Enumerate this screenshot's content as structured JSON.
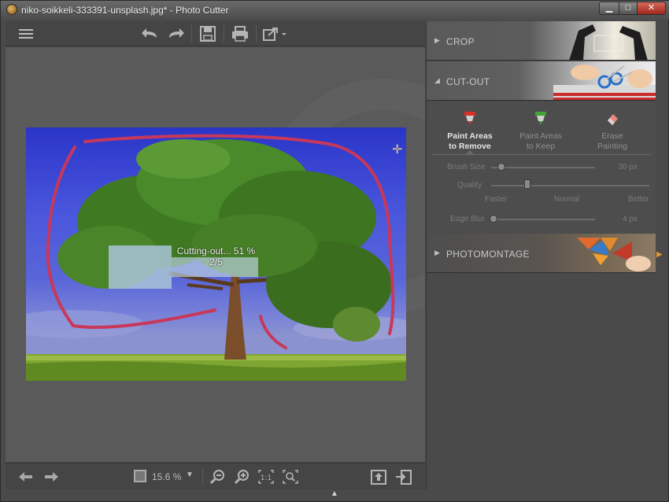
{
  "window": {
    "title": "niko-soikkeli-333391-unsplash.jpg* - Photo Cutter",
    "minimize": "▁",
    "maximize": "□",
    "close": "✕"
  },
  "toolbar": {
    "icons": [
      "menu-icon",
      "undo-icon",
      "redo-icon",
      "save-icon",
      "print-icon",
      "export-icon"
    ]
  },
  "canvas": {
    "progress_line1": "Cutting-out... 51 %",
    "progress_line2": "2/5",
    "progress_percent": 51
  },
  "bottombar": {
    "zoom": "15.6 %",
    "icons": [
      "prev-arrow-icon",
      "next-arrow-icon",
      "zoom-out-icon",
      "zoom-in-icon",
      "actual-size-icon",
      "fit-icon",
      "upload-icon",
      "exit-icon"
    ]
  },
  "panel": {
    "crop": {
      "label": "CROP"
    },
    "cutout": {
      "label": "CUT-OUT",
      "modes": {
        "remove": {
          "line1": "Paint Areas",
          "line2": "to Remove"
        },
        "keep": {
          "line1": "Paint Areas",
          "line2": "to Keep"
        },
        "erase": {
          "line1": "Erase",
          "line2": "Painting"
        }
      },
      "brush_size": {
        "label": "Brush Size",
        "value": "30 px",
        "level": 0.08
      },
      "quality": {
        "label": "Quality",
        "faster": "Faster",
        "normal": "Normal",
        "better": "Better",
        "level": 0.3
      },
      "edge_blur": {
        "label": "Edge Blur",
        "value": "4 px",
        "level": 0.04
      }
    },
    "photomontage": {
      "label": "PHOTOMONTAGE"
    }
  },
  "colors": {
    "remove_accent": "#d9302a",
    "keep_accent": "#3fa535",
    "erase_accent": "#e8897f",
    "stroke": "#c8385a",
    "side_arrow": "#e39530"
  }
}
